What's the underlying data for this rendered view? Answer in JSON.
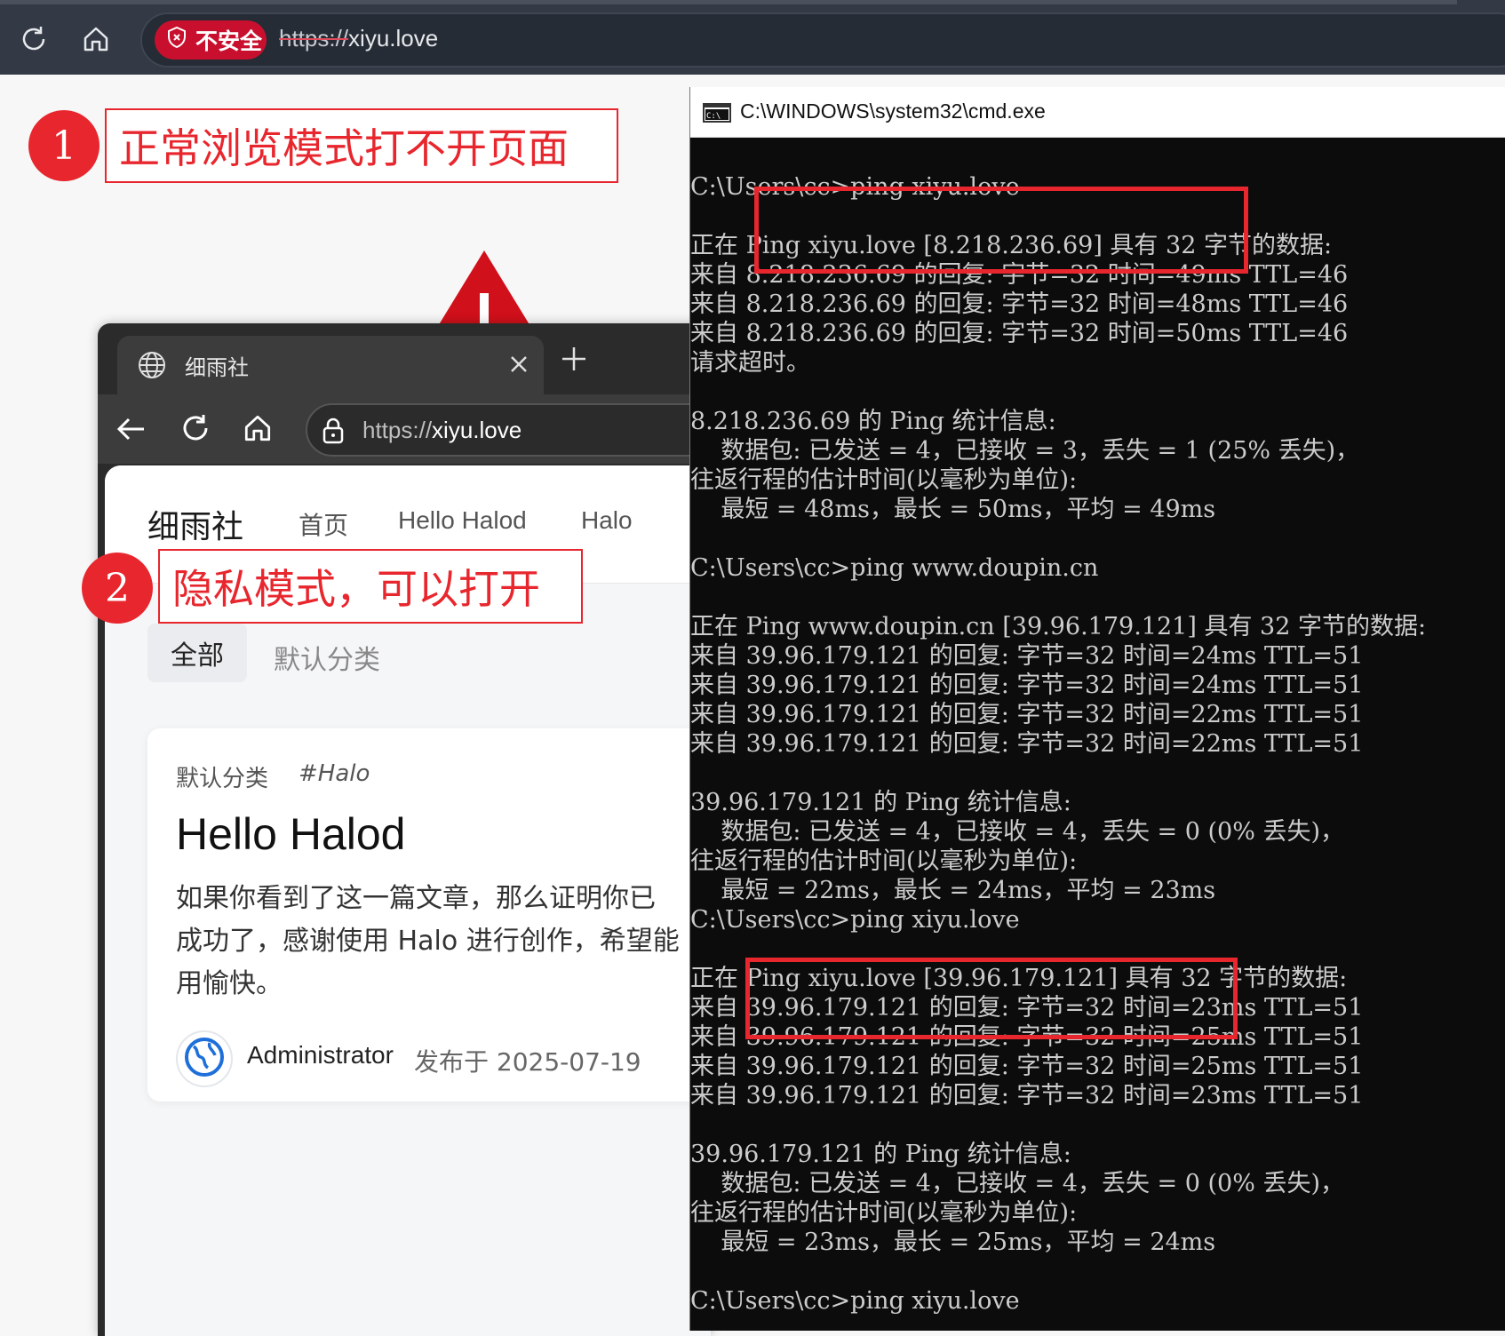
{
  "main_browser": {
    "security_label": "不安全",
    "url_scheme": "https://",
    "url_host": "xiyu.love"
  },
  "annotations": [
    {
      "number": "1",
      "text": "正常浏览模式打不开页面"
    },
    {
      "number": "2",
      "text": "隐私模式，可以打开"
    }
  ],
  "private_browser": {
    "tab_title": "细雨社",
    "url_scheme": "https://",
    "url_host": "xiyu.love",
    "site": {
      "logo": "细雨社",
      "nav": [
        "首页",
        "Hello Halod",
        "Halo"
      ],
      "categories": [
        "全部",
        "默认分类"
      ],
      "post": {
        "category": "默认分类",
        "tag": "#Halo",
        "title": "Hello Halod",
        "excerpt": "如果你看到了这一篇文章，那么证明你已经安装成功了，感谢使用 Halo 进行创作，希望能够使用愉快。",
        "excerpt_lines": [
          "如果你看到了这一篇文章，那么证明你已",
          "成功了，感谢使用 Halo 进行创作，希望能",
          "用愉快。"
        ],
        "author": "Administrator",
        "date": "发布于 2025-07-19"
      }
    }
  },
  "cmd": {
    "title": "C:\\WINDOWS\\system32\\cmd.exe",
    "lines": [
      "C:\\Users\\cc>ping xiyu.love",
      "",
      "正在 Ping xiyu.love [8.218.236.69] 具有 32 字节的数据:",
      "来自 8.218.236.69 的回复: 字节=32 时间=49ms TTL=46",
      "来自 8.218.236.69 的回复: 字节=32 时间=48ms TTL=46",
      "来自 8.218.236.69 的回复: 字节=32 时间=50ms TTL=46",
      "请求超时。",
      "",
      "8.218.236.69 的 Ping 统计信息:",
      "    数据包: 已发送 = 4，已接收 = 3，丢失 = 1 (25% 丢失)，",
      "往返行程的估计时间(以毫秒为单位):",
      "    最短 = 48ms，最长 = 50ms，平均 = 49ms",
      "",
      "C:\\Users\\cc>ping www.doupin.cn",
      "",
      "正在 Ping www.doupin.cn [39.96.179.121] 具有 32 字节的数据:",
      "来自 39.96.179.121 的回复: 字节=32 时间=24ms TTL=51",
      "来自 39.96.179.121 的回复: 字节=32 时间=24ms TTL=51",
      "来自 39.96.179.121 的回复: 字节=32 时间=22ms TTL=51",
      "来自 39.96.179.121 的回复: 字节=32 时间=22ms TTL=51",
      "",
      "39.96.179.121 的 Ping 统计信息:",
      "    数据包: 已发送 = 4，已接收 = 4，丢失 = 0 (0% 丢失)，",
      "往返行程的估计时间(以毫秒为单位):",
      "    最短 = 22ms，最长 = 24ms，平均 = 23ms",
      "C:\\Users\\cc>ping xiyu.love",
      "",
      "正在 Ping xiyu.love [39.96.179.121] 具有 32 字节的数据:",
      "来自 39.96.179.121 的回复: 字节=32 时间=23ms TTL=51",
      "来自 39.96.179.121 的回复: 字节=32 时间=25ms TTL=51",
      "来自 39.96.179.121 的回复: 字节=32 时间=25ms TTL=51",
      "来自 39.96.179.121 的回复: 字节=32 时间=23ms TTL=51",
      "",
      "39.96.179.121 的 Ping 统计信息:",
      "    数据包: 已发送 = 4，已接收 = 4，丢失 = 0 (0% 丢失)，",
      "往返行程的估计时间(以毫秒为单位):",
      "    最短 = 23ms，最长 = 25ms，平均 = 24ms",
      "",
      "C:\\Users\\cc>ping xiyu.love"
    ]
  },
  "colors": {
    "accent_red": "#e8262d",
    "insecure_badge": "#c8102e",
    "cmd_bg": "#0c0c0c",
    "cmd_text": "#cccccc"
  },
  "icons": [
    "reload-icon",
    "home-icon",
    "shield-icon",
    "warning-icon",
    "globe-icon",
    "close-icon",
    "plus-icon",
    "back-icon",
    "lock-icon",
    "cmd-icon",
    "avatar-globe-icon"
  ]
}
